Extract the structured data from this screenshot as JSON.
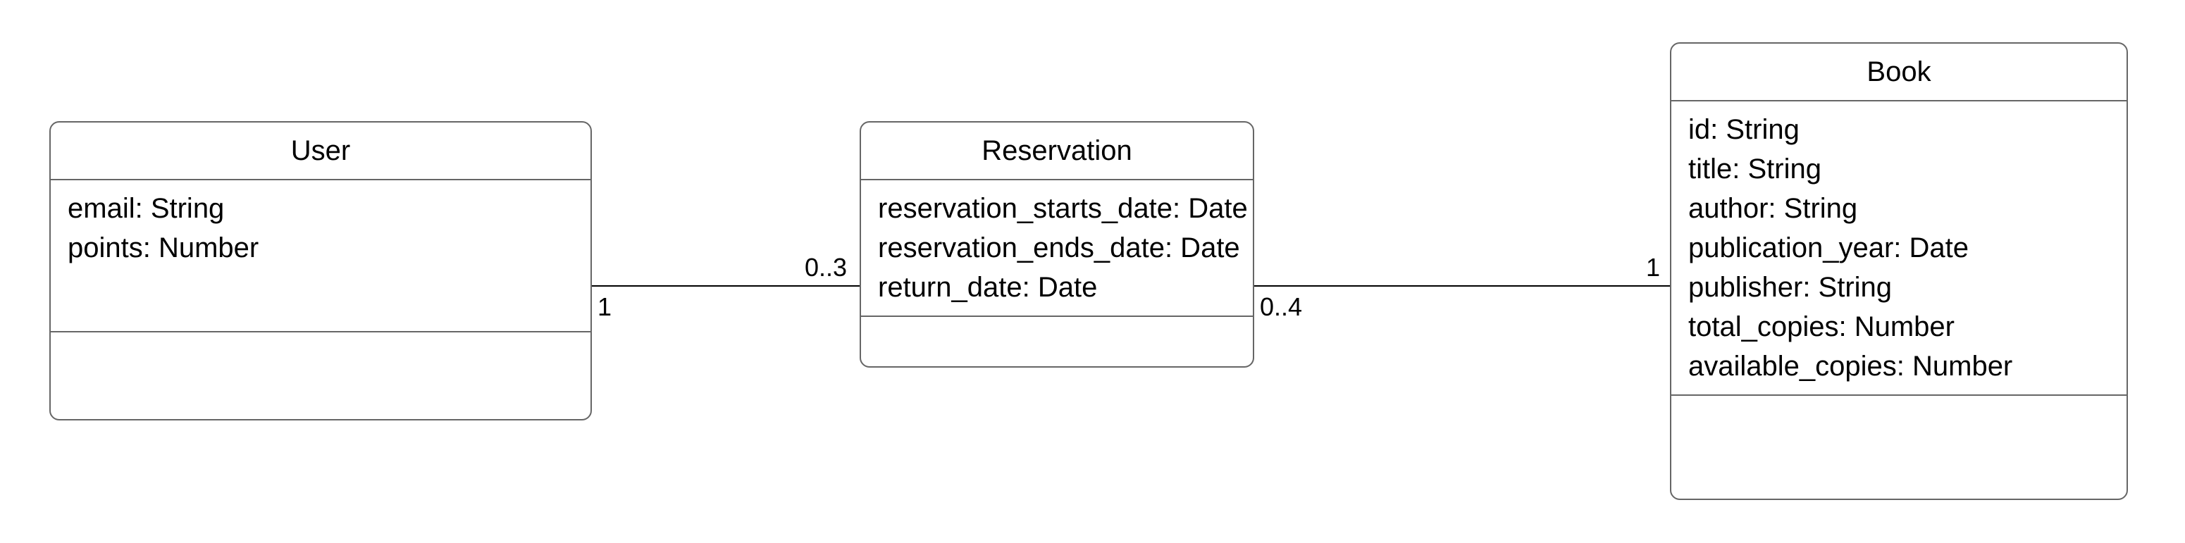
{
  "classes": {
    "user": {
      "name": "User",
      "attributes": [
        "email: String",
        "points: Number"
      ]
    },
    "reservation": {
      "name": "Reservation",
      "attributes": [
        "reservation_starts_date: Date",
        "reservation_ends_date: Date",
        "return_date: Date"
      ]
    },
    "book": {
      "name": "Book",
      "attributes": [
        "id: String",
        "title: String",
        "author: String",
        "publication_year: Date",
        "publisher: String",
        "total_copies: Number",
        "available_copies: Number"
      ]
    }
  },
  "associations": {
    "user_reservation": {
      "left_multiplicity": "1",
      "right_multiplicity": "0..3"
    },
    "reservation_book": {
      "left_multiplicity": "0..4",
      "right_multiplicity": "1"
    }
  }
}
